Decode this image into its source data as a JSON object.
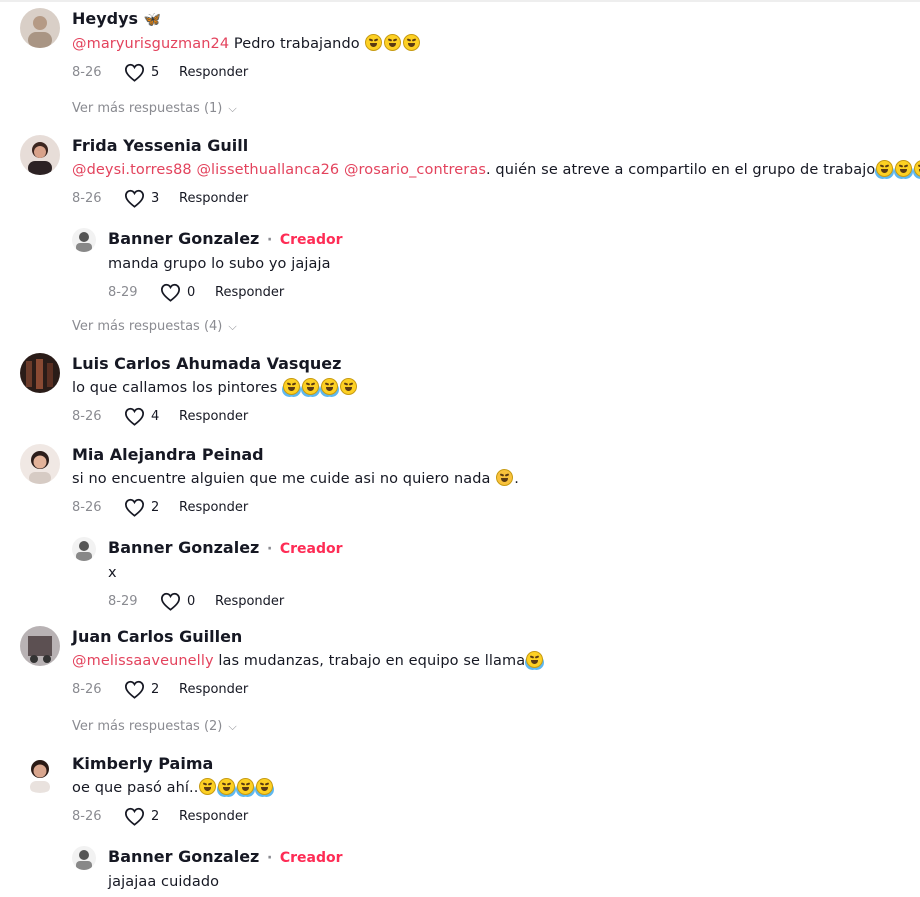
{
  "comments": [
    {
      "name": "Heydys",
      "name_icon": "butterfly-icon",
      "text_parts": [
        {
          "type": "mention",
          "text": "@maryurisguzman24"
        },
        {
          "type": "text",
          "text": " Pedro trabajando "
        },
        {
          "type": "emoji",
          "name": "rofl-emoji"
        },
        {
          "type": "emoji",
          "name": "rofl-emoji"
        },
        {
          "type": "emoji",
          "name": "rofl-emoji"
        }
      ],
      "date": "8-26",
      "likes": "5",
      "reply_label": "Responder",
      "more_replies": "Ver más respuestas (1)"
    },
    {
      "name": "Frida Yessenia Guill",
      "text_parts": [
        {
          "type": "mention",
          "text": "@deysi.torres88"
        },
        {
          "type": "text",
          "text": " "
        },
        {
          "type": "mention",
          "text": "@lissethuallanca26"
        },
        {
          "type": "text",
          "text": " "
        },
        {
          "type": "mention",
          "text": "@rosario_contreras"
        },
        {
          "type": "text",
          "text": ". quién se atreve a compartilo en el grupo de trabajo"
        },
        {
          "type": "emoji",
          "name": "tears-of-joy-emoji"
        },
        {
          "type": "emoji",
          "name": "tears-of-joy-emoji"
        },
        {
          "type": "emoji",
          "name": "tears-of-joy-emoji"
        },
        {
          "type": "emoji",
          "name": "tears-of-joy-emoji"
        }
      ],
      "date": "8-26",
      "likes": "3",
      "reply_label": "Responder",
      "reply": {
        "name": "Banner Gonzalez",
        "separator": "·",
        "tag": "Creador",
        "text": "manda grupo lo subo yo jajaja",
        "date": "8-29",
        "likes": "0",
        "reply_label": "Responder"
      },
      "more_replies": "Ver más respuestas (4)"
    },
    {
      "name": "Luis Carlos Ahumada Vasquez",
      "text_parts": [
        {
          "type": "text",
          "text": "lo que callamos los pintores "
        },
        {
          "type": "emoji",
          "name": "tears-of-joy-emoji"
        },
        {
          "type": "emoji",
          "name": "tears-of-joy-emoji"
        },
        {
          "type": "emoji",
          "name": "tears-of-joy-emoji"
        },
        {
          "type": "emoji",
          "name": "grinning-sweat-emoji"
        }
      ],
      "date": "8-26",
      "likes": "4",
      "reply_label": "Responder"
    },
    {
      "name": "Mia Alejandra Peinad",
      "text_parts": [
        {
          "type": "text",
          "text": "si no encuentre alguien que me cuide asi no quiero nada "
        },
        {
          "type": "emoji",
          "name": "smiling-hearts-emoji"
        },
        {
          "type": "text",
          "text": "."
        }
      ],
      "date": "8-26",
      "likes": "2",
      "reply_label": "Responder",
      "reply": {
        "name": "Banner Gonzalez",
        "separator": "·",
        "tag": "Creador",
        "text": "x",
        "date": "8-29",
        "likes": "0",
        "reply_label": "Responder"
      }
    },
    {
      "name": "Juan Carlos Guillen",
      "text_parts": [
        {
          "type": "mention",
          "text": "@melissaaveunelly"
        },
        {
          "type": "text",
          "text": " las mudanzas, trabajo en equipo se llama"
        },
        {
          "type": "emoji",
          "name": "tears-of-joy-emoji"
        }
      ],
      "date": "8-26",
      "likes": "2",
      "reply_label": "Responder",
      "more_replies": "Ver más respuestas (2)"
    },
    {
      "name": "Kimberly Paima",
      "text_parts": [
        {
          "type": "text",
          "text": "oe que pasó ahí.."
        },
        {
          "type": "emoji",
          "name": "squinting-tongue-emoji"
        },
        {
          "type": "emoji",
          "name": "tears-of-joy-emoji"
        },
        {
          "type": "emoji",
          "name": "tears-of-joy-emoji"
        },
        {
          "type": "emoji",
          "name": "tears-of-joy-emoji"
        }
      ],
      "date": "8-26",
      "likes": "2",
      "reply_label": "Responder",
      "reply": {
        "name": "Banner Gonzalez",
        "separator": "·",
        "tag": "Creador",
        "text": "jajajaa cuidado"
      }
    }
  ],
  "icons": {
    "like": "heart-outline-icon",
    "expand": "chevron-down-icon"
  },
  "colors": {
    "mention": "#e3435d",
    "creator_tag": "#fe2c55",
    "meta_gray": "#8a8b91",
    "text": "#161823"
  }
}
